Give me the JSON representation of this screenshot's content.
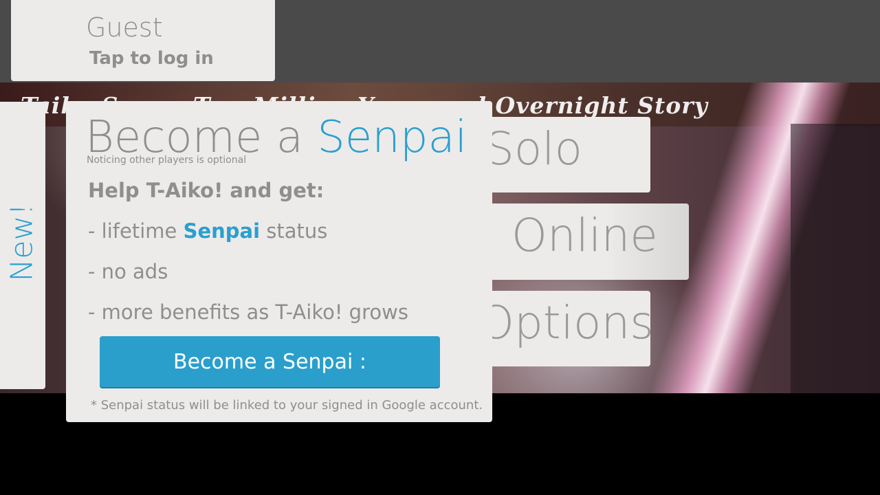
{
  "account": {
    "name": "Guest",
    "action": "Tap to log in"
  },
  "banner": {
    "title": "Taiko Saga - Two Million Years and Overnight Story"
  },
  "menu": {
    "solo": "Solo",
    "online": "Online",
    "options": "Options"
  },
  "side_tab": {
    "label": "New!"
  },
  "senpai_dialog": {
    "title_prefix": "Become a ",
    "title_accent": "Senpai",
    "subtitle": "Noticing other players is optional",
    "heading": "Help T-Aiko! and get:",
    "benefit1_prefix": "- lifetime ",
    "benefit1_accent": "Senpai",
    "benefit1_suffix": " status",
    "benefit2": "- no ads",
    "benefit3": "- more benefits as T-Aiko! grows",
    "button_label": "Become a Senpai :",
    "footnote": "* Senpai status will be linked to your signed in Google account."
  },
  "colors": {
    "accent": "#2a9fd0",
    "card_bg": "#ecebe9",
    "text_grey": "#8e8e8e",
    "topbar": "#4a4a4a"
  }
}
